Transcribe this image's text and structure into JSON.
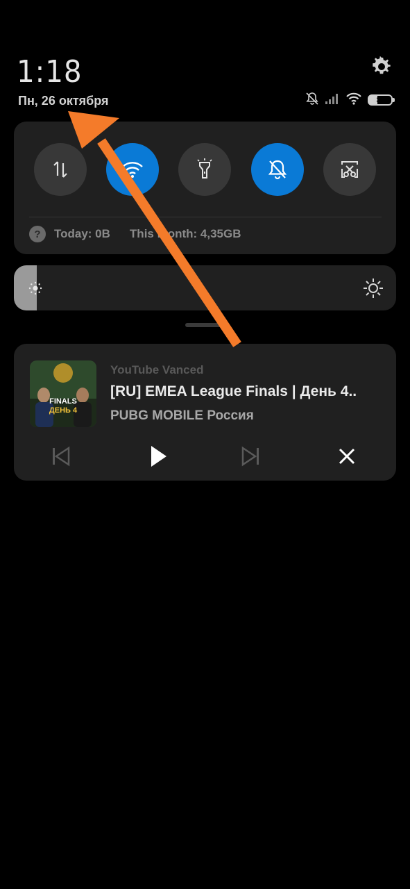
{
  "header": {
    "time": "1:18",
    "date": "Пн, 26 октября",
    "battery_level": "37",
    "icons": [
      "settings-gear-icon",
      "bell-muted-icon",
      "signal-icon",
      "wifi-icon",
      "battery-icon"
    ]
  },
  "quick_settings": {
    "toggles": [
      {
        "icon": "mobile-data-icon",
        "active": false
      },
      {
        "icon": "wifi-icon",
        "active": true
      },
      {
        "icon": "flashlight-icon",
        "active": false
      },
      {
        "icon": "silent-mode-icon",
        "active": true
      },
      {
        "icon": "screenshot-icon",
        "active": false
      }
    ],
    "data_usage": {
      "today": "Today: 0B",
      "month": "This month: 4,35GB"
    }
  },
  "brightness": {
    "level": 0.06
  },
  "media": {
    "app": "YouTube Vanced",
    "title": "[RU] EMEA League Finals | День 4..",
    "artist": "PUBG MOBILE Россия",
    "thumbnail": {
      "line1": "FINALS",
      "line2": "ДЕНЬ 4"
    },
    "controls": [
      "previous-icon",
      "play-icon",
      "next-icon",
      "close-icon"
    ]
  },
  "colors": {
    "accent": "#0a7ad6",
    "panel": "#202020",
    "annotation_arrow": "#f47b2a"
  }
}
